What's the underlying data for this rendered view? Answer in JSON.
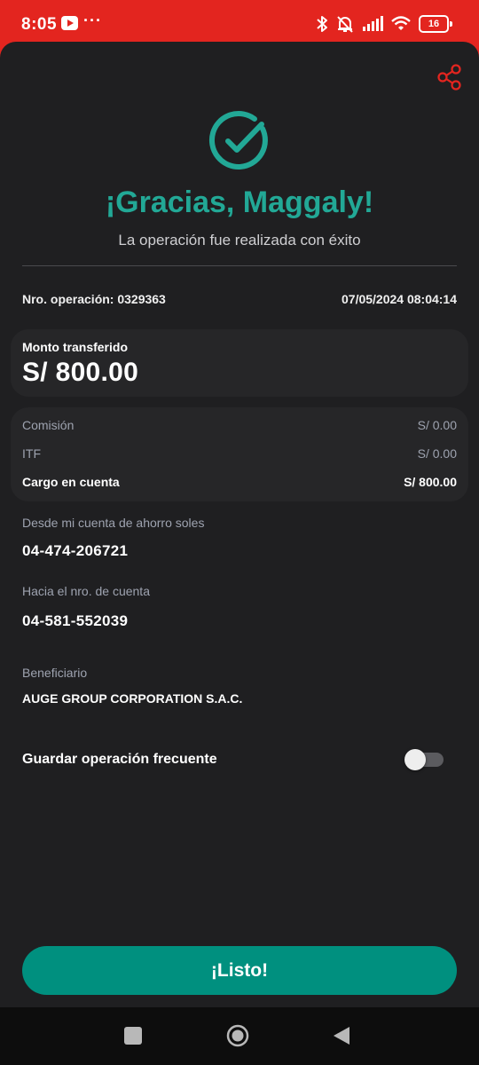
{
  "status_bar": {
    "time": "8:05",
    "dots": "···",
    "battery": "16"
  },
  "colors": {
    "accent": "#22a896",
    "button": "#00907f",
    "share": "#e3251f",
    "status_bar": "#e3251f",
    "card_bg": "#1f1f21"
  },
  "header": {
    "share_icon": "share-icon",
    "success_icon": "check-circle-icon",
    "title": "¡Gracias, Maggaly!",
    "subtitle": "La operación fue realizada con éxito"
  },
  "operation": {
    "number_label": "Nro. operación: 0329363",
    "datetime": "07/05/2024 08:04:14"
  },
  "amount": {
    "label": "Monto transferido",
    "value": "S/ 800.00"
  },
  "fees": [
    {
      "label": "Comisión",
      "value": "S/ 0.00"
    },
    {
      "label": "ITF",
      "value": "S/ 0.00"
    },
    {
      "label": "Cargo en cuenta",
      "value": "S/ 800.00"
    }
  ],
  "from_account": {
    "label": "Desde mi cuenta de ahorro soles",
    "value": "04-474-206721"
  },
  "to_account": {
    "label": "Hacia el nro. de cuenta",
    "value": "04-581-552039"
  },
  "beneficiary": {
    "label": "Beneficiario",
    "value": "AUGE GROUP CORPORATION S.A.C."
  },
  "save_frequent": {
    "label": "Guardar operación frecuente",
    "enabled": false
  },
  "button": {
    "label": "¡Listo!"
  },
  "nav": [
    "recents-icon",
    "home-icon",
    "back-icon"
  ]
}
